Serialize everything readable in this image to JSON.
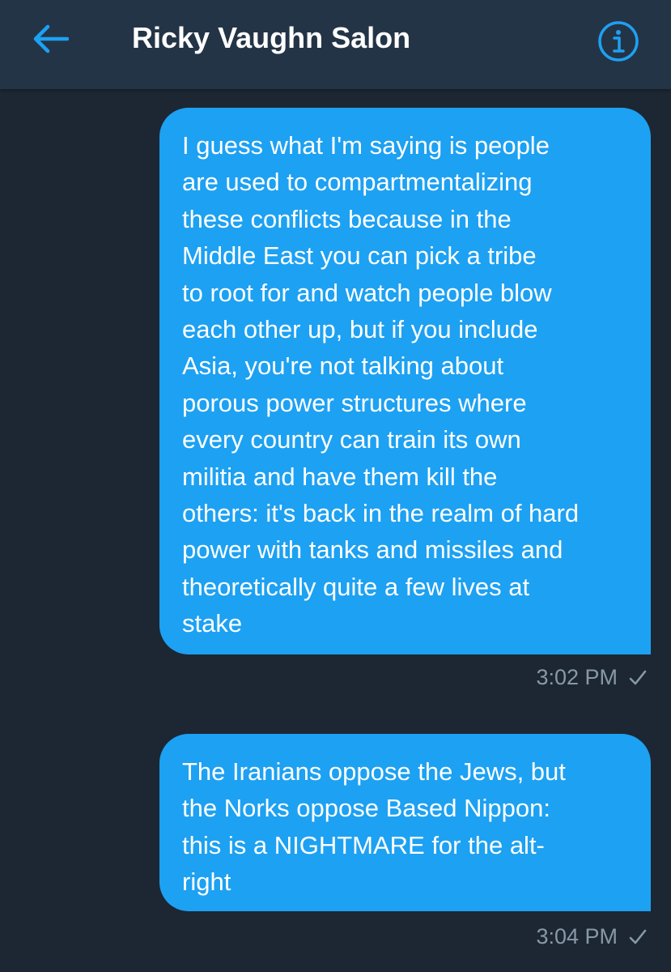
{
  "header": {
    "title": "Ricky Vaughn Salon",
    "back_icon": "back-arrow-icon",
    "info_icon": "info-icon"
  },
  "colors": {
    "background": "#1c2733",
    "header": "#243447",
    "accent": "#1da1f2",
    "meta_text": "#8899a6"
  },
  "messages": [
    {
      "text": "I guess what I'm saying is people\nare used to compartmentalizing\nthese conflicts because in the\nMiddle East you can pick a tribe\nto root for and watch people blow\neach other up, but if you include\nAsia, you're not talking about\nporous power structures where\nevery country can train its own\nmilitia and have them kill the\nothers: it's back in the realm of hard\npower with tanks and missiles and\ntheoretically quite a few lives at\nstake",
      "time": "3:02 PM",
      "status_icon": "sent-check-icon"
    },
    {
      "text": "The Iranians oppose the Jews, but\nthe Norks oppose Based Nippon:\nthis is a NIGHTMARE for the alt-\nright",
      "time": "3:04 PM",
      "status_icon": "sent-check-icon"
    }
  ]
}
